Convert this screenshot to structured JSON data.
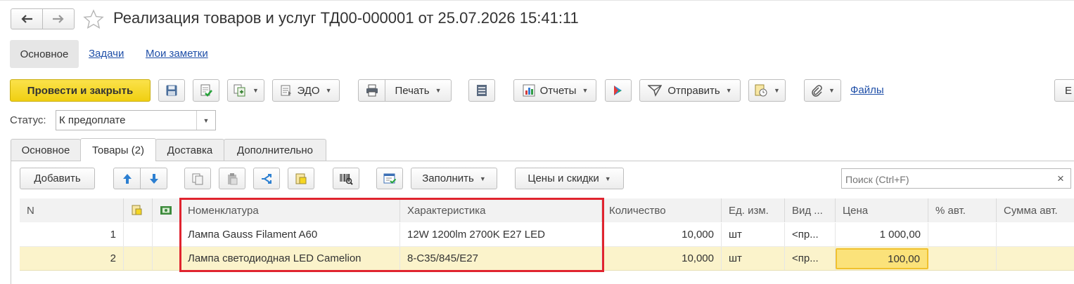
{
  "window": {
    "title": "Реализация товаров и услуг ТД00-000001 от 25.07.2026 15:41:11"
  },
  "nav": {
    "items": [
      {
        "label": "Основное",
        "active": true
      },
      {
        "label": "Задачи",
        "active": false
      },
      {
        "label": "Мои заметки",
        "active": false
      }
    ]
  },
  "toolbar": {
    "post_close_label": "Провести и закрыть",
    "edo_label": "ЭДО",
    "print_label": "Печать",
    "reports_label": "Отчеты",
    "send_label": "Отправить",
    "files_label": "Файлы",
    "more_label": "Е"
  },
  "status": {
    "label": "Статус:",
    "value": "К предоплате"
  },
  "tabs": [
    {
      "label": "Основное",
      "active": false
    },
    {
      "label": "Товары (2)",
      "active": true
    },
    {
      "label": "Доставка",
      "active": false
    },
    {
      "label": "Дополнительно",
      "active": false
    }
  ],
  "goods_toolbar": {
    "add_label": "Добавить",
    "fill_label": "Заполнить",
    "prices_label": "Цены и скидки",
    "search_placeholder": "Поиск (Ctrl+F)",
    "clear_label": "×"
  },
  "table": {
    "columns": [
      "N",
      "Номенклатура",
      "Характеристика",
      "Количество",
      "Ед. изм.",
      "Вид ...",
      "Цена",
      "% авт.",
      "Сумма авт."
    ],
    "rows": [
      {
        "n": "1",
        "item": "Лампа Gauss Filament A60",
        "characteristic": "12W 1200lm 2700K E27 LED",
        "qty": "10,000",
        "unit": "шт",
        "kind": "<пр...",
        "price": "1 000,00",
        "pct": "",
        "sum": ""
      },
      {
        "n": "2",
        "item": "Лампа светодиодная LED Camelion",
        "characteristic": "8-C35/845/E27",
        "qty": "10,000",
        "unit": "шт",
        "kind": "<пр...",
        "price": "100,00",
        "pct": "",
        "sum": ""
      }
    ]
  },
  "colors": {
    "primary_button": "#f5d622",
    "selected_row": "#fbf3cb",
    "highlight_border": "#e0242f",
    "link": "#1f4fa8"
  }
}
